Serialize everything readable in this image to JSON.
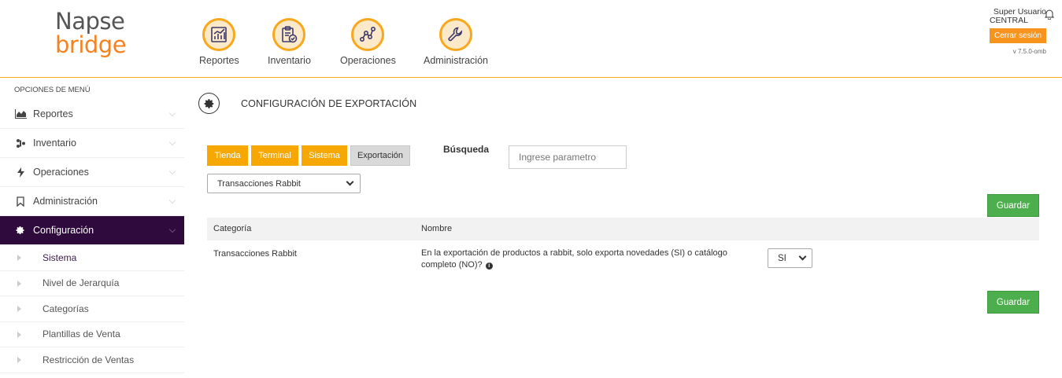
{
  "brand": {
    "line1": "Napse",
    "line2": "bridge"
  },
  "nav": [
    {
      "label": "Reportes",
      "icon": "chart-icon"
    },
    {
      "label": "Inventario",
      "icon": "clipboard-check-icon"
    },
    {
      "label": "Operaciones",
      "icon": "nodes-icon"
    },
    {
      "label": "Administración",
      "icon": "wrench-icon"
    }
  ],
  "user": {
    "name": "Super Usuario",
    "store": "CENTRAL",
    "logout_label": "Cerrar sesión",
    "version": "v 7.5.0-omb"
  },
  "sidebar": {
    "title": "OPCIONES DE MENÚ",
    "items": [
      {
        "label": "Reportes",
        "icon": "area-chart-icon"
      },
      {
        "label": "Inventario",
        "icon": "sitemap-icon"
      },
      {
        "label": "Operaciones",
        "icon": "bolt-icon"
      },
      {
        "label": "Administración",
        "icon": "bookmark-icon"
      },
      {
        "label": "Configuración",
        "icon": "gear-icon",
        "active": true
      }
    ],
    "subitems": [
      {
        "label": "Sistema",
        "active": true
      },
      {
        "label": "Nivel de Jerarquía"
      },
      {
        "label": "Categorías"
      },
      {
        "label": "Plantillas de Venta"
      },
      {
        "label": "Restricción de Ventas"
      }
    ]
  },
  "page": {
    "title": "CONFIGURACIÓN DE EXPORTACIÓN"
  },
  "tabs": [
    {
      "label": "Tienda"
    },
    {
      "label": "Terminal"
    },
    {
      "label": "Sistema"
    },
    {
      "label": "Exportación",
      "active": true
    }
  ],
  "search": {
    "label": "Búsqueda",
    "placeholder": "Ingrese parametro",
    "value": ""
  },
  "category_select": {
    "selected": "Transacciones Rabbit"
  },
  "save_label": "Guardar",
  "table": {
    "headers": {
      "category": "Categoría",
      "name": "Nombre"
    },
    "rows": [
      {
        "category": "Transacciones Rabbit",
        "name": "En la exportación de productos a rabbit, solo exporta novedades (SI) o catálogo completo (NO)?",
        "value": "SI"
      }
    ]
  },
  "colors": {
    "accent_orange": "#f7a800",
    "sidebar_active": "#2e0a3d",
    "save_green": "#4cae4c",
    "logo_gray": "#555555",
    "logo_orange": "#f58220"
  }
}
